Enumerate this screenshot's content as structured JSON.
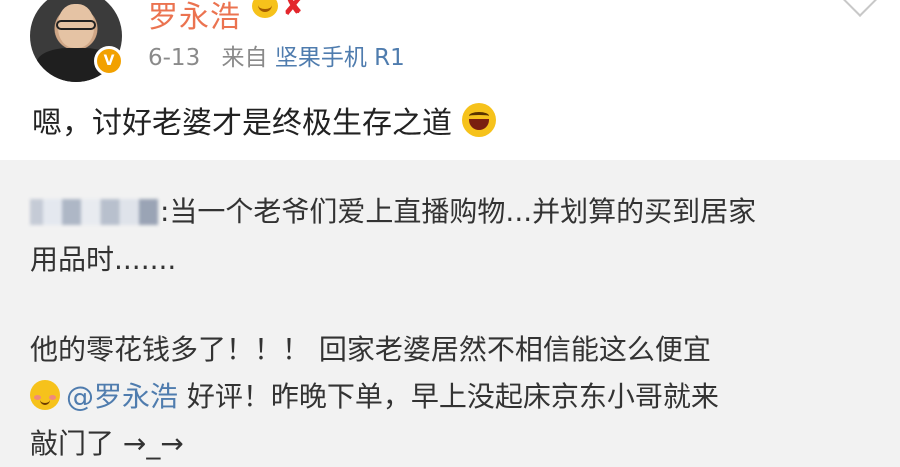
{
  "post": {
    "username": "罗永浩",
    "date": "6-13",
    "source_prefix": "来自",
    "source_device": "坚果手机 R1",
    "text": "嗯，讨好老婆才是终极生存之道",
    "verified_badge": "V",
    "emoji_after_text": "laugh-icon"
  },
  "quote": {
    "line1": ":当一个老爷们爱上直播购物...并划算的买到居家",
    "line2": "用品时.......",
    "line3": "他的零花钱多了！！！ 回家老婆居然不相信能这么便宜",
    "line4_mention": "@罗永浩",
    "line4_rest": " 好评！昨晚下单，早上没起床京东小哥就来",
    "line5": "敲门了 →_→"
  },
  "colors": {
    "username": "#eb7350",
    "link": "#4f7cae",
    "quote_bg": "#f2f2f2",
    "meta": "#8a8a8a"
  }
}
